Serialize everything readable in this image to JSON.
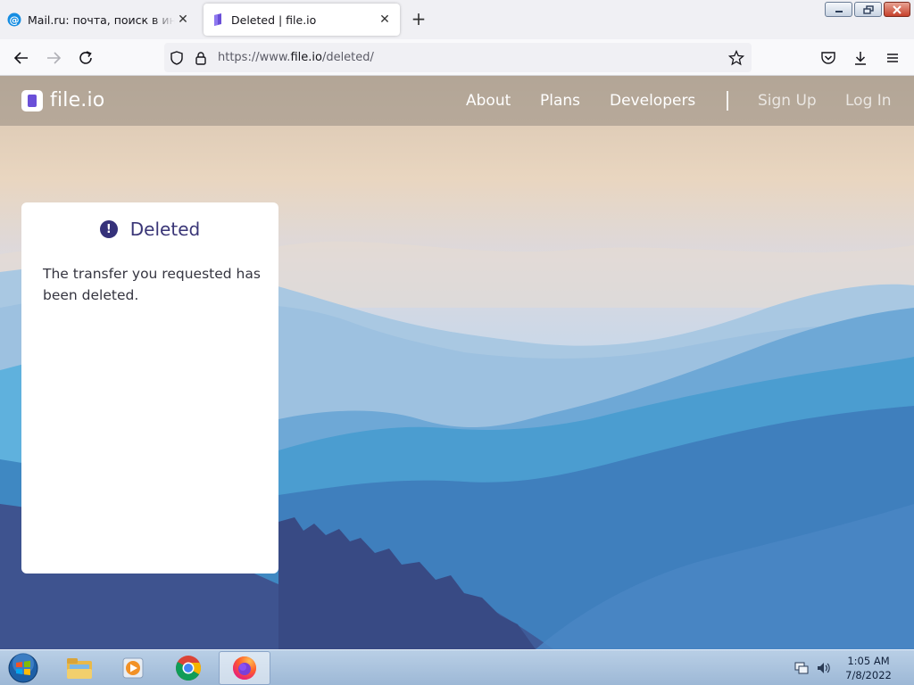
{
  "browser": {
    "tabs": [
      {
        "title": "Mail.ru: почта, поиск в интернете",
        "favicon": "mailru-at-icon",
        "active": false
      },
      {
        "title": "Deleted | file.io",
        "favicon": "fileio-icon",
        "active": true
      }
    ],
    "new_tab_symbol": "+",
    "close_symbol": "✕",
    "url_prefix": "https://www.",
    "url_domain": "file.io",
    "url_path": "/deleted/"
  },
  "site": {
    "logo_text": "file.io",
    "nav": [
      "About",
      "Plans",
      "Developers"
    ],
    "sign_up": "Sign Up",
    "log_in": "Log In"
  },
  "card": {
    "icon_glyph": "!",
    "title": "Deleted",
    "message": "The transfer you requested has been deleted."
  },
  "taskbar": {
    "time": "1:05 AM",
    "date": "7/8/2022",
    "apps": [
      "explorer-icon",
      "media-player-icon",
      "chrome-icon",
      "firefox-icon"
    ]
  }
}
